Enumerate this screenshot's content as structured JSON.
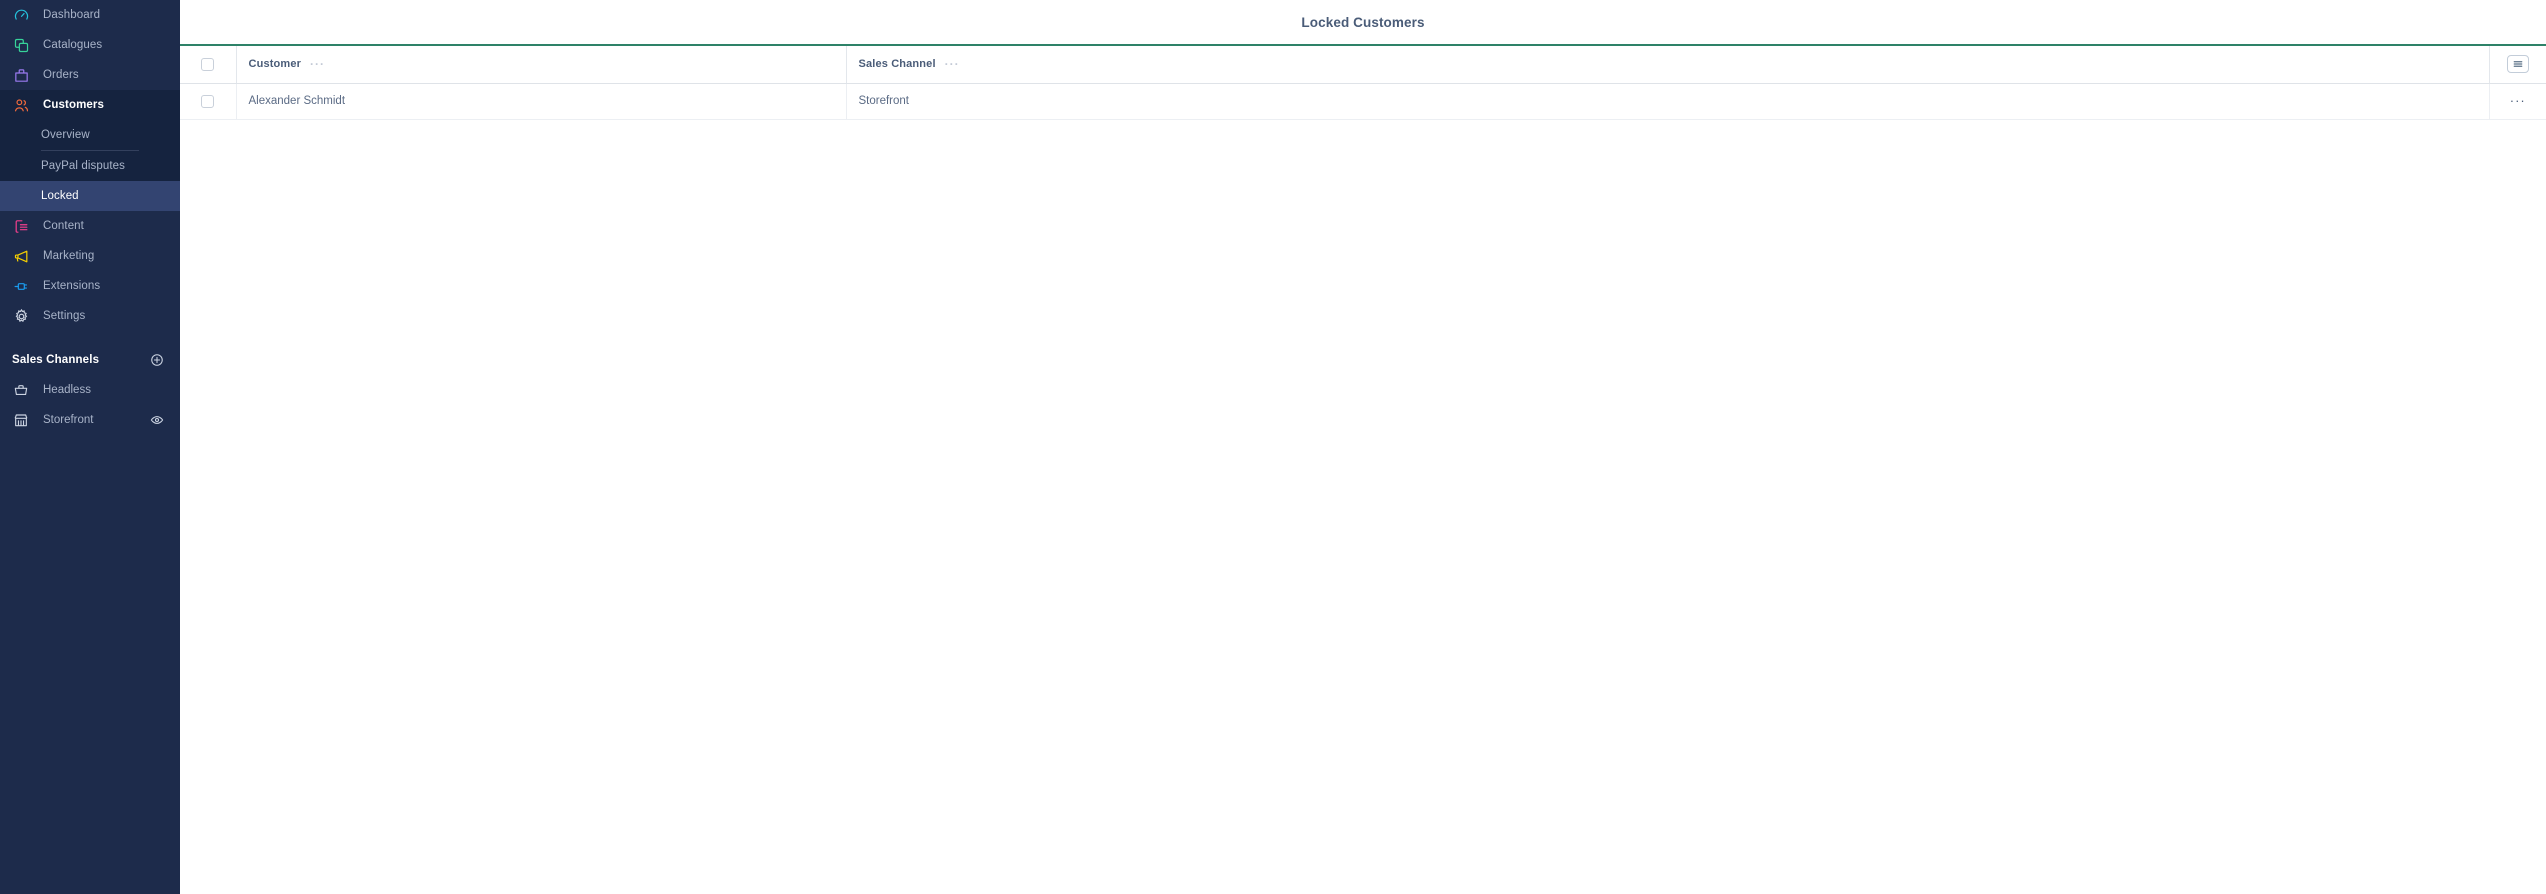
{
  "theme": {
    "sidebar_bg": "#1d2b4b",
    "sidebar_group_active_bg": "#15233f",
    "sidebar_selected_bg": "#334471",
    "accent_rule": "#2e8268",
    "text_muted": "#a9b4c9",
    "heading": "#4a5c78"
  },
  "sidebar": {
    "items": [
      {
        "label": "Dashboard",
        "icon": "gauge-icon",
        "color": "#25c3dd"
      },
      {
        "label": "Catalogues",
        "icon": "layers-icon",
        "color": "#37d39a"
      },
      {
        "label": "Orders",
        "icon": "bag-icon",
        "color": "#9a7af0"
      },
      {
        "label": "Customers",
        "icon": "users-icon",
        "color": "#f06a3c"
      },
      {
        "label": "Content",
        "icon": "content-icon",
        "color": "#f43f8e"
      },
      {
        "label": "Marketing",
        "icon": "megaphone-icon",
        "color": "#f5cf00"
      },
      {
        "label": "Extensions",
        "icon": "plug-icon",
        "color": "#1a9cf0"
      },
      {
        "label": "Settings",
        "icon": "gear-icon",
        "color": "#c8d0de"
      }
    ],
    "customers_subitems": [
      {
        "label": "Overview",
        "selected": false
      },
      {
        "label": "PayPal disputes",
        "selected": false
      },
      {
        "label": "Locked",
        "selected": true
      }
    ],
    "sales_channels": {
      "title": "Sales Channels",
      "add_icon": "plus-circle-icon",
      "channels": [
        {
          "label": "Headless",
          "icon": "basket-icon",
          "has_preview": false
        },
        {
          "label": "Storefront",
          "icon": "store-icon",
          "has_preview": true,
          "preview_icon": "eye-icon"
        }
      ]
    }
  },
  "header": {
    "title": "Locked Customers"
  },
  "table": {
    "select_all_checked": false,
    "columns_button_icon": "columns-settings-icon",
    "column_menu_glyph": "···",
    "row_menu_glyph": "···",
    "columns": [
      {
        "key": "customer",
        "label": "Customer"
      },
      {
        "key": "sales_channel",
        "label": "Sales Channel"
      }
    ],
    "rows": [
      {
        "checked": false,
        "customer": "Alexander Schmidt",
        "sales_channel": "Storefront"
      }
    ]
  }
}
